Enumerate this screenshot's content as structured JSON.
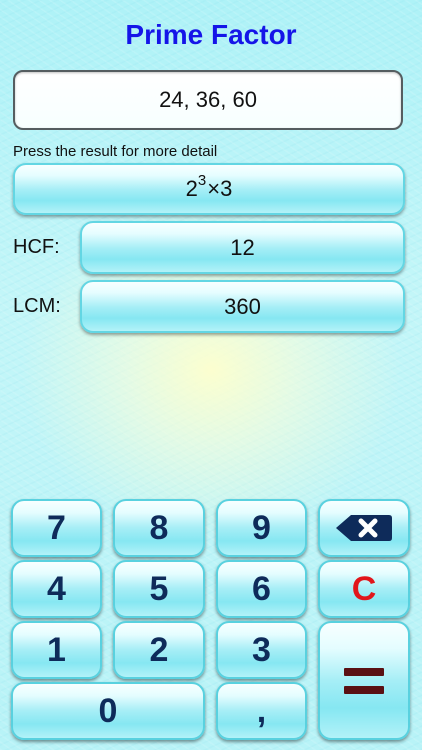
{
  "app": {
    "title": "Prime Factor"
  },
  "input": {
    "value": "24, 36, 60"
  },
  "hint": "Press the result for more detail",
  "result": {
    "factorization": {
      "base1": "2",
      "exp1": "3",
      "times": "×",
      "base2": "3"
    },
    "hcf": {
      "label": "HCF:",
      "value": "12"
    },
    "lcm": {
      "label": "LCM:",
      "value": "360"
    }
  },
  "keypad": {
    "keys": {
      "k7": "7",
      "k8": "8",
      "k9": "9",
      "k4": "4",
      "k5": "5",
      "k6": "6",
      "k1": "1",
      "k2": "2",
      "k3": "3",
      "k0": "0",
      "comma": ",",
      "clear": "C"
    },
    "icons": {
      "backspace": "backspace-icon",
      "equals": "equals-icon"
    }
  },
  "colors": {
    "title": "#1515e8",
    "key_text": "#0e2b5a",
    "clear": "#e1161b",
    "equals": "#5a1013",
    "backspace": "#0e2b5a"
  }
}
